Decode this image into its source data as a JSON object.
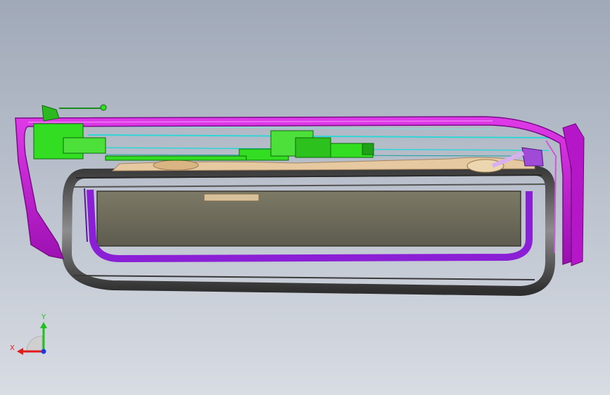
{
  "viewport": {
    "background_top": "#a0a9b8",
    "background_bottom": "#d8dce3"
  },
  "model": {
    "parts": [
      {
        "name": "outer-frame",
        "color": "#c21bd0"
      },
      {
        "name": "mechanism",
        "color": "#33dd22"
      },
      {
        "name": "cables",
        "color": "#2fd6d6"
      },
      {
        "name": "headliner",
        "color": "#e6c9a0"
      },
      {
        "name": "glass-seal",
        "color": "#4a4a4a"
      },
      {
        "name": "glass-panel",
        "color": "#6e6a58"
      },
      {
        "name": "inner-frame",
        "color": "#8a1fd6"
      }
    ]
  },
  "triad": {
    "x_label": "X",
    "y_label": "Y",
    "x_color": "#e21b1b",
    "y_color": "#20c020",
    "z_color": "#1b3be2"
  }
}
